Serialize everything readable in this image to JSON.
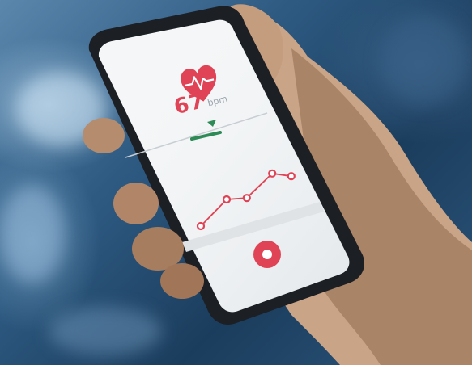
{
  "app": {
    "heart_rate": {
      "value": "67",
      "unit": "bpm"
    },
    "icons": {
      "heart": "heart-pulse-icon",
      "indicator": "triangle-down-icon",
      "record": "record-button-icon"
    },
    "chart_points": [
      {
        "x": 1,
        "y": 1
      },
      {
        "x": 2,
        "y": 3
      },
      {
        "x": 3,
        "y": 2.6
      },
      {
        "x": 4,
        "y": 4.4
      },
      {
        "x": 5,
        "y": 3.6
      }
    ]
  },
  "colors": {
    "accent_red": "#e04355",
    "indicator_green": "#2e8b57",
    "screen_white": "#f4f6f7",
    "phone_frame": "#1c1f24"
  }
}
